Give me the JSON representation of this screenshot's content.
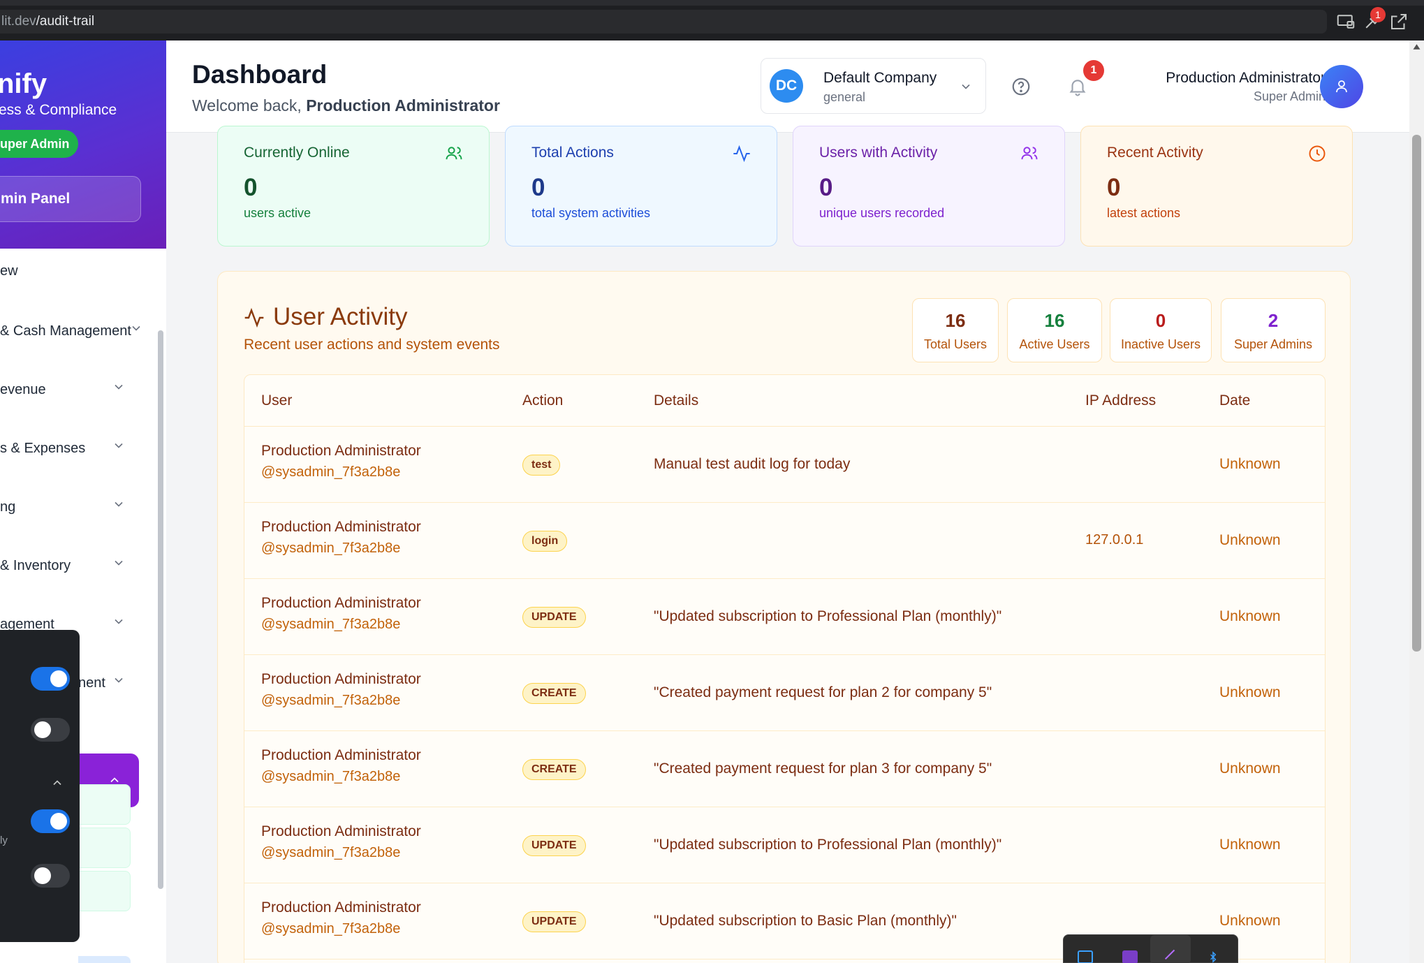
{
  "browser": {
    "url_host": "lit.dev",
    "url_path": "/audit-trail",
    "badge_count": "1"
  },
  "sidebar": {
    "brand_name": "nify",
    "brand_subtitle": "ess & Compliance",
    "role_pill": "uper Admin",
    "admin_panel": "min Panel",
    "items": [
      {
        "label": "ew"
      },
      {
        "label": "& Cash Management"
      },
      {
        "label": "evenue"
      },
      {
        "label": "s & Expenses"
      },
      {
        "label": "ng"
      },
      {
        "label": "& Inventory"
      },
      {
        "label": "agement"
      },
      {
        "label": "nent"
      }
    ]
  },
  "float_panel": {
    "label": "ly",
    "toggles": [
      true,
      false,
      true,
      false
    ]
  },
  "header": {
    "title": "Dashboard",
    "welcome_prefix": "Welcome back, ",
    "welcome_name": "Production Administrator",
    "company": {
      "initials": "DC",
      "name": "Default Company",
      "type": "general"
    },
    "notification_count": "1",
    "user": {
      "name": "Production Administrator",
      "role": "Super Admin"
    }
  },
  "stats": [
    {
      "title": "Currently Online",
      "value": "0",
      "sub": "users active",
      "icon": "users-icon"
    },
    {
      "title": "Total Actions",
      "value": "0",
      "sub": "total system activities",
      "icon": "activity-icon"
    },
    {
      "title": "Users with Activity",
      "value": "0",
      "sub": "unique users recorded",
      "icon": "users-icon"
    },
    {
      "title": "Recent Activity",
      "value": "0",
      "sub": "latest actions",
      "icon": "clock-icon"
    }
  ],
  "activity": {
    "title": "User Activity",
    "subtitle": "Recent user actions and system events",
    "mini_stats": [
      {
        "value": "16",
        "label": "Total Users",
        "color": "#7c2d12"
      },
      {
        "value": "16",
        "label": "Active Users",
        "color": "#15803d"
      },
      {
        "value": "0",
        "label": "Inactive Users",
        "color": "#b91c1c"
      },
      {
        "value": "2",
        "label": "Super Admins",
        "color": "#7e22ce"
      }
    ],
    "columns": [
      "User",
      "Action",
      "Details",
      "IP Address",
      "Date"
    ],
    "rows": [
      {
        "user": "Production Administrator",
        "handle": "@sysadmin_7f3a2b8e",
        "action": "test",
        "details": "Manual test audit log for today",
        "ip": "",
        "date": "Unknown"
      },
      {
        "user": "Production Administrator",
        "handle": "@sysadmin_7f3a2b8e",
        "action": "login",
        "details": "",
        "ip": "127.0.0.1",
        "date": "Unknown"
      },
      {
        "user": "Production Administrator",
        "handle": "@sysadmin_7f3a2b8e",
        "action": "UPDATE",
        "details": "\"Updated subscription to Professional Plan (monthly)\"",
        "ip": "",
        "date": "Unknown"
      },
      {
        "user": "Production Administrator",
        "handle": "@sysadmin_7f3a2b8e",
        "action": "CREATE",
        "details": "\"Created payment request for plan 2 for company 5\"",
        "ip": "",
        "date": "Unknown"
      },
      {
        "user": "Production Administrator",
        "handle": "@sysadmin_7f3a2b8e",
        "action": "CREATE",
        "details": "\"Created payment request for plan 3 for company 5\"",
        "ip": "",
        "date": "Unknown"
      },
      {
        "user": "Production Administrator",
        "handle": "@sysadmin_7f3a2b8e",
        "action": "UPDATE",
        "details": "\"Updated subscription to Professional Plan (monthly)\"",
        "ip": "",
        "date": "Unknown"
      },
      {
        "user": "Production Administrator",
        "handle": "@sysadmin_7f3a2b8e",
        "action": "UPDATE",
        "details": "\"Updated subscription to Basic Plan (monthly)\"",
        "ip": "",
        "date": "Unknown"
      }
    ]
  },
  "colors": {
    "sidebar_gradient_start": "#3b3fe0",
    "sidebar_gradient_end": "#6a1fb8",
    "role_green": "#1fb24b",
    "active_purple": "#8a22d8",
    "activity_accent": "#8a3a0c"
  }
}
